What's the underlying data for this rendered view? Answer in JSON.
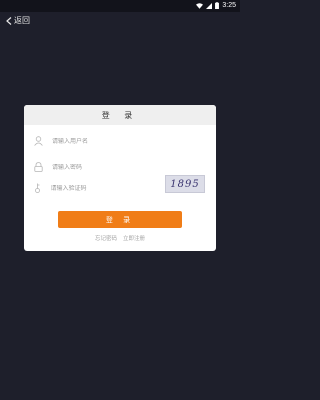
{
  "status": {
    "time": "3:25"
  },
  "nav": {
    "back_label": "返回"
  },
  "login": {
    "title": "登 录",
    "username_placeholder": "请输入用户名",
    "password_placeholder": "请输入密码",
    "captcha_placeholder": "请输入验证码",
    "captcha_text": "1895",
    "submit_label": "登 录",
    "forgot_label": "忘记密码",
    "register_label": "立即注册"
  },
  "icons": [
    "wifi-icon",
    "signal-icon",
    "battery-icon",
    "back-icon",
    "user-icon",
    "lock-icon",
    "key-icon"
  ],
  "colors": {
    "background": "#1e1f2b",
    "accent": "#f07d17",
    "card": "#ffffff",
    "card_header": "#efefef"
  }
}
